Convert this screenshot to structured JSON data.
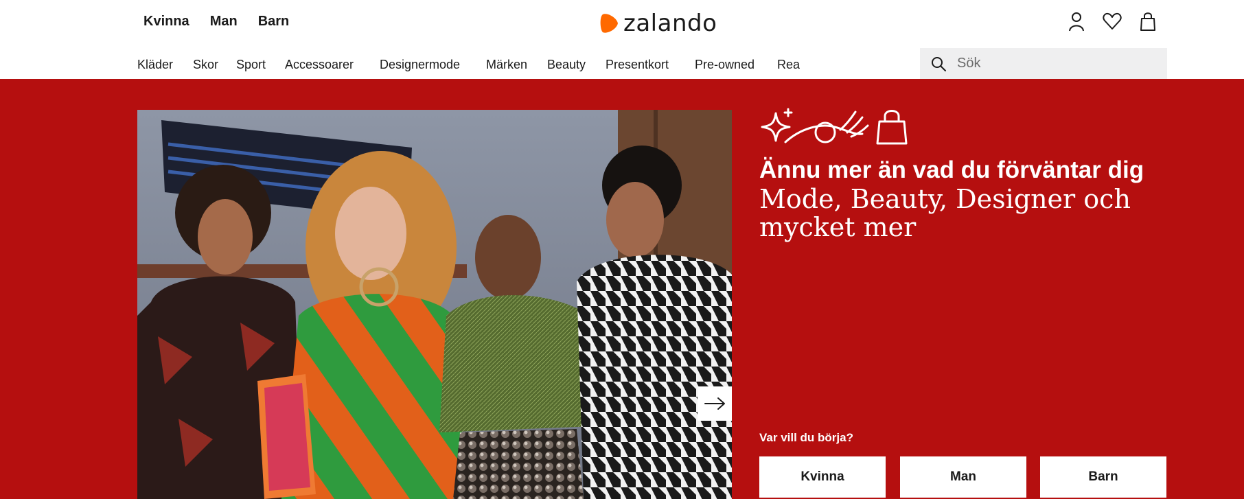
{
  "header": {
    "gender_nav": [
      "Kvinna",
      "Man",
      "Barn"
    ],
    "logo_text": "zalando",
    "brand_color": "#ff6900",
    "icons": [
      "user-icon",
      "heart-icon",
      "shopping-bag-icon"
    ]
  },
  "category_nav": [
    "Kläder",
    "Skor",
    "Sport",
    "Accessoarer",
    "Designermode",
    "Märken",
    "Beauty",
    "Presentkort",
    "Pre-owned",
    "Rea"
  ],
  "search": {
    "placeholder": "Sök"
  },
  "hero": {
    "background_color": "#b50f0f",
    "headline": "Ännu mer än vad du förväntar dig",
    "subline": "Mode, Beauty, Designer och mycket mer",
    "start_label": "Var vill du börja?",
    "choices": [
      "Kvinna",
      "Man",
      "Barn"
    ]
  }
}
